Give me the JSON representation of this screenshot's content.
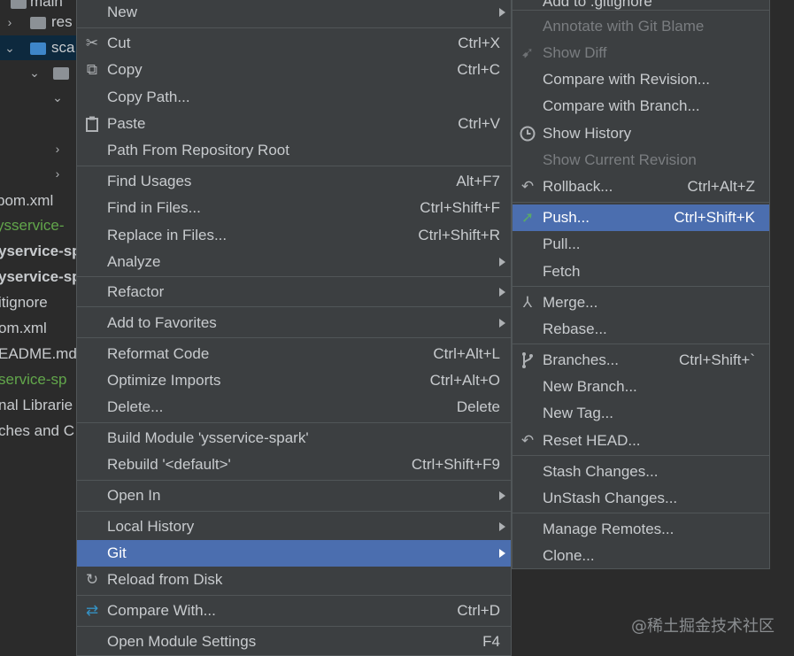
{
  "tree": {
    "rows": [
      {
        "text": "main"
      },
      {
        "text": "res"
      },
      {
        "text": "sca"
      },
      {
        "text": ""
      },
      {
        "text": ""
      },
      {
        "text": ""
      },
      {
        "text": ""
      },
      {
        "text": "pom.xml"
      },
      {
        "text": "ysservice-"
      },
      {
        "text": "yservice-sp"
      },
      {
        "text": "yservice-sp"
      },
      {
        "text": "itignore"
      },
      {
        "text": "om.xml"
      },
      {
        "text": "EADME.md"
      },
      {
        "text": "service-sp"
      },
      {
        "text": "nal Librarie"
      },
      {
        "text": "ches and C"
      }
    ]
  },
  "main_menu": {
    "items": [
      {
        "label": "New",
        "shortcut": ""
      },
      {
        "label": "Cut",
        "shortcut": "Ctrl+X",
        "icon": "✂"
      },
      {
        "label": "Copy",
        "shortcut": "Ctrl+C",
        "icon": "⧉"
      },
      {
        "label": "Copy Path...",
        "shortcut": ""
      },
      {
        "label": "Paste",
        "shortcut": "Ctrl+V",
        "icon": "📋"
      },
      {
        "label": "Path From Repository Root",
        "shortcut": ""
      },
      {
        "label": "Find Usages",
        "shortcut": "Alt+F7"
      },
      {
        "label": "Find in Files...",
        "shortcut": "Ctrl+Shift+F"
      },
      {
        "label": "Replace in Files...",
        "shortcut": "Ctrl+Shift+R"
      },
      {
        "label": "Analyze",
        "shortcut": ""
      },
      {
        "label": "Refactor",
        "shortcut": ""
      },
      {
        "label": "Add to Favorites",
        "shortcut": ""
      },
      {
        "label": "Reformat Code",
        "shortcut": "Ctrl+Alt+L"
      },
      {
        "label": "Optimize Imports",
        "shortcut": "Ctrl+Alt+O"
      },
      {
        "label": "Delete...",
        "shortcut": "Delete"
      },
      {
        "label": "Build Module 'ysservice-spark'",
        "shortcut": ""
      },
      {
        "label": "Rebuild '<default>'",
        "shortcut": "Ctrl+Shift+F9"
      },
      {
        "label": "Open In",
        "shortcut": ""
      },
      {
        "label": "Local History",
        "shortcut": ""
      },
      {
        "label": "Git",
        "shortcut": ""
      },
      {
        "label": "Reload from Disk",
        "shortcut": "",
        "icon": "↻"
      },
      {
        "label": "Compare With...",
        "shortcut": "Ctrl+D",
        "icon": "⇄"
      },
      {
        "label": "Open Module Settings",
        "shortcut": "F4"
      }
    ]
  },
  "git_submenu": {
    "items": [
      {
        "label": "Add to .gitignore",
        "shortcut": ""
      },
      {
        "label": "Annotate with Git Blame",
        "shortcut": ""
      },
      {
        "label": "Show Diff",
        "shortcut": ""
      },
      {
        "label": "Compare with Revision...",
        "shortcut": ""
      },
      {
        "label": "Compare with Branch...",
        "shortcut": ""
      },
      {
        "label": "Show History",
        "shortcut": "",
        "icon": "🕘"
      },
      {
        "label": "Show Current Revision",
        "shortcut": ""
      },
      {
        "label": "Rollback...",
        "shortcut": "Ctrl+Alt+Z",
        "icon": "↶"
      },
      {
        "label": "Push...",
        "shortcut": "Ctrl+Shift+K",
        "icon": "➚"
      },
      {
        "label": "Pull...",
        "shortcut": ""
      },
      {
        "label": "Fetch",
        "shortcut": ""
      },
      {
        "label": "Merge...",
        "shortcut": "",
        "icon": "⅄"
      },
      {
        "label": "Rebase...",
        "shortcut": ""
      },
      {
        "label": "Branches...",
        "shortcut": "Ctrl+Shift+`",
        "icon": "ᚴ"
      },
      {
        "label": "New Branch...",
        "shortcut": ""
      },
      {
        "label": "New Tag...",
        "shortcut": ""
      },
      {
        "label": "Reset HEAD...",
        "shortcut": "",
        "icon": "↶"
      },
      {
        "label": "Stash Changes...",
        "shortcut": ""
      },
      {
        "label": "UnStash Changes...",
        "shortcut": ""
      },
      {
        "label": "Manage Remotes...",
        "shortcut": ""
      },
      {
        "label": "Clone...",
        "shortcut": ""
      }
    ]
  },
  "watermark": "@稀土掘金技术社区",
  "colors": {
    "background": "#2b2b2b",
    "menu_bg": "#3c3f41",
    "highlight": "#4b6eaf",
    "push_arrow": "#59a869",
    "compare_icon": "#3592c4"
  }
}
